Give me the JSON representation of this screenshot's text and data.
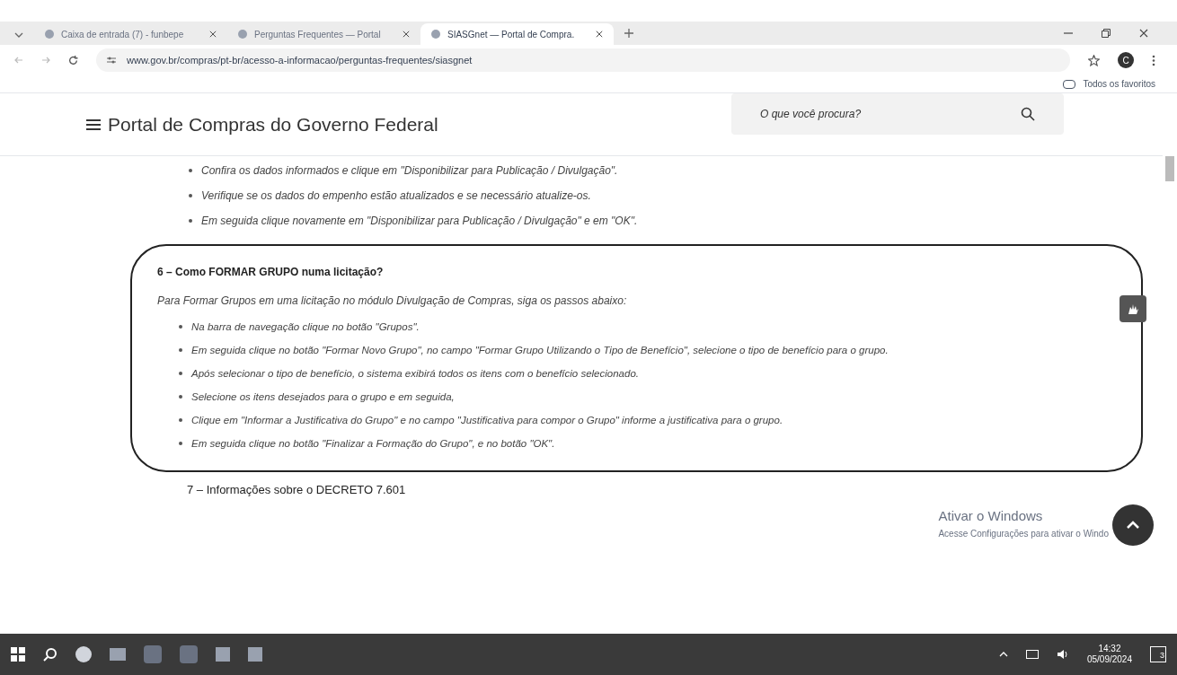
{
  "browser": {
    "tabs": [
      {
        "title": "Caixa de entrada (7) - funbepe",
        "selected": false
      },
      {
        "title": "Perguntas Frequentes — Portal",
        "selected": false
      },
      {
        "title": "SIASGnet — Portal de Compra.",
        "selected": true
      }
    ],
    "address": "www.gov.br/compras/pt-br/acesso-a-informacao/perguntas-frequentes/siasgnet",
    "profile_initial": "C",
    "bookmarks_folder": "Todos os favoritos"
  },
  "site": {
    "title": "Portal de Compras do Governo Federal",
    "search": {
      "placeholder": "O que você procura?"
    }
  },
  "previous_steps": [
    "Confira os dados informados e clique em \"Disponibilizar para Publicação / Divulgação\".",
    "Verifique se os dados do empenho estão atualizados e se necessário atualize-os.",
    "Em seguida clique novamente em \"Disponibilizar para Publicação / Divulgação\" e em \"OK\"."
  ],
  "faq": {
    "title": "6 – Como FORMAR GRUPO numa licitação?",
    "intro": "Para Formar Grupos em uma licitação no módulo Divulgação de Compras, siga os passos abaixo:",
    "steps": [
      "Na barra de navegação clique no botão \"Grupos\".",
      "Em seguida clique no botão \"Formar Novo Grupo\", no campo \"Formar Grupo Utilizando o Tipo de Benefício\", selecione o tipo de benefício para o grupo.",
      "Após selecionar o tipo de benefício, o sistema exibirá todos os itens com o benefício selecionado.",
      "Selecione os itens desejados para o grupo e em seguida,",
      "Clique em \"Informar a Justificativa do Grupo\" e no campo \"Justificativa para compor o Grupo\" informe a justificativa para o grupo.",
      "Em seguida clique no botão \"Finalizar a Formação do Grupo\", e no botão \"OK\"."
    ]
  },
  "next_faq_title": "7 – Informações sobre o DECRETO 7.601",
  "activation": {
    "title": "Ativar o Windows",
    "subtitle": "Acesse Configurações para ativar o Windo"
  },
  "taskbar": {
    "time": "14:32",
    "date": "05/09/2024",
    "notifications": "3"
  }
}
